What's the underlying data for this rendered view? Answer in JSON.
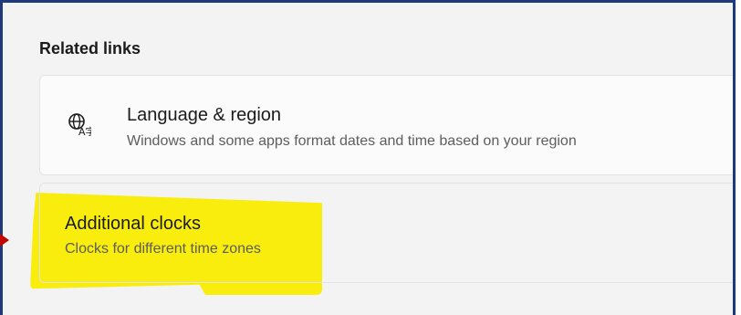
{
  "section": {
    "title": "Related links"
  },
  "links": [
    {
      "title": "Language & region",
      "subtitle": "Windows and some apps format dates and time based on your region",
      "icon": "globe-language-icon"
    },
    {
      "title": "Additional clocks",
      "subtitle": "Clocks for different time zones"
    }
  ],
  "colors": {
    "frame_border": "#1f3a7a",
    "highlight": "#f8ec00",
    "annotation_arrow": "#c40000"
  }
}
